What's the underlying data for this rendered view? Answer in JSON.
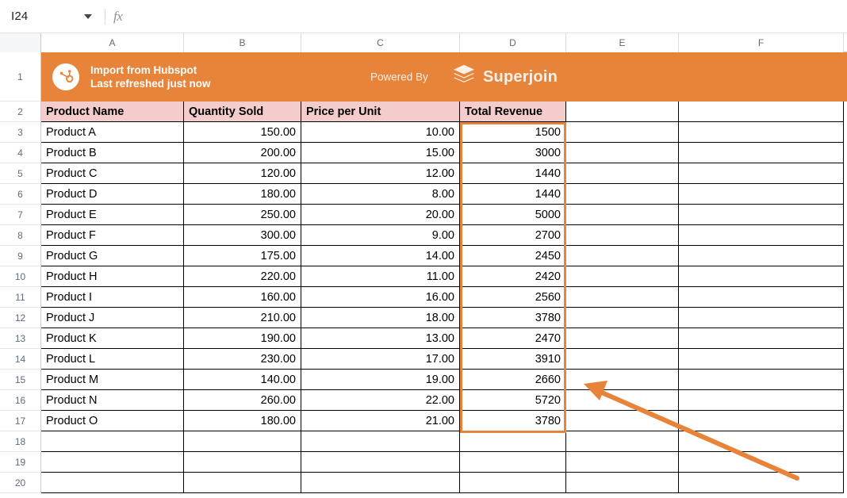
{
  "formula_bar": {
    "name_box_value": "I24",
    "fx_label": "fx",
    "formula_value": ""
  },
  "grid": {
    "column_headers": [
      "A",
      "B",
      "C",
      "D",
      "E",
      "F"
    ],
    "row_numbers": [
      "1",
      "2",
      "3",
      "4",
      "5",
      "6",
      "7",
      "8",
      "9",
      "10",
      "11",
      "12",
      "13",
      "14",
      "15",
      "16",
      "17",
      "18",
      "19",
      "20"
    ]
  },
  "banner": {
    "title": "Import from Hubspot",
    "subtitle": "Last refreshed just now",
    "powered_by": "Powered By",
    "brand": "Superjoin",
    "background_color": "#E8833A",
    "source_icon": "hubspot-sprocket-icon",
    "brand_icon": "superjoin-layers-icon"
  },
  "table": {
    "headers": [
      "Product Name",
      "Quantity Sold",
      "Price per Unit",
      "Total Revenue"
    ],
    "header_background": "#F4CCCC",
    "rows": [
      {
        "product": "Product A",
        "quantity": "150.00",
        "price": "10.00",
        "revenue": "1500"
      },
      {
        "product": "Product B",
        "quantity": "200.00",
        "price": "15.00",
        "revenue": "3000"
      },
      {
        "product": "Product C",
        "quantity": "120.00",
        "price": "12.00",
        "revenue": "1440"
      },
      {
        "product": "Product D",
        "quantity": "180.00",
        "price": "8.00",
        "revenue": "1440"
      },
      {
        "product": "Product E",
        "quantity": "250.00",
        "price": "20.00",
        "revenue": "5000"
      },
      {
        "product": "Product F",
        "quantity": "300.00",
        "price": "9.00",
        "revenue": "2700"
      },
      {
        "product": "Product G",
        "quantity": "175.00",
        "price": "14.00",
        "revenue": "2450"
      },
      {
        "product": "Product H",
        "quantity": "220.00",
        "price": "11.00",
        "revenue": "2420"
      },
      {
        "product": "Product I",
        "quantity": "160.00",
        "price": "16.00",
        "revenue": "2560"
      },
      {
        "product": "Product J",
        "quantity": "210.00",
        "price": "18.00",
        "revenue": "3780"
      },
      {
        "product": "Product K",
        "quantity": "190.00",
        "price": "13.00",
        "revenue": "2470"
      },
      {
        "product": "Product L",
        "quantity": "230.00",
        "price": "17.00",
        "revenue": "3910"
      },
      {
        "product": "Product M",
        "quantity": "140.00",
        "price": "19.00",
        "revenue": "2660"
      },
      {
        "product": "Product N",
        "quantity": "260.00",
        "price": "22.00",
        "revenue": "5720"
      },
      {
        "product": "Product O",
        "quantity": "180.00",
        "price": "21.00",
        "revenue": "3780"
      }
    ]
  },
  "annotation": {
    "arrow_color": "#E8833A",
    "points_to": "total-revenue-column"
  }
}
